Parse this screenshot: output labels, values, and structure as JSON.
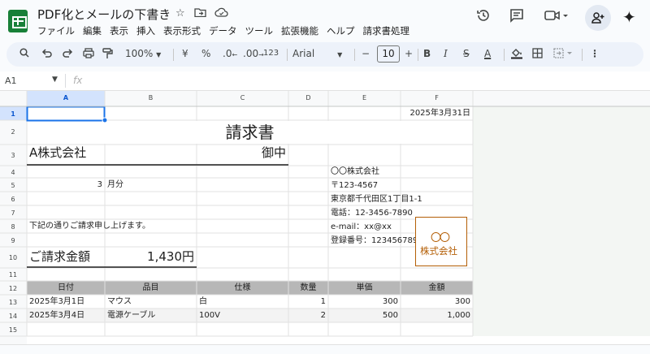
{
  "app": {
    "doc_title": "PDF化とメールの下書き",
    "menu": [
      "ファイル",
      "編集",
      "表示",
      "挿入",
      "表示形式",
      "データ",
      "ツール",
      "拡張機能",
      "ヘルプ",
      "請求書処理"
    ]
  },
  "toolbar": {
    "zoom": "100%",
    "currency": "¥",
    "percent": "%",
    "decrease_decimal": ".0",
    "increase_decimal": ".00",
    "number_format": "123",
    "font": "Arial",
    "font_size": "10",
    "bold": "B",
    "italic": "I",
    "strike": "S",
    "text_color": "A"
  },
  "formula_bar": {
    "name_box": "A1",
    "fx": "fx"
  },
  "columns": [
    "A",
    "B",
    "C",
    "D",
    "E",
    "F"
  ],
  "rows": [
    "1",
    "2",
    "3",
    "4",
    "5",
    "6",
    "7",
    "8",
    "9",
    "10",
    "11",
    "12",
    "13",
    "14",
    "15"
  ],
  "invoice": {
    "date": "2025年3月31日",
    "title": "請求書",
    "client": "A株式会社",
    "honorific": "御中",
    "month_number": "3",
    "month_label": "月分",
    "message": "下記の通りご請求申し上げます。",
    "amount_label": "ご請求金額",
    "amount_value": "1,430円",
    "company": "〇〇株式会社",
    "postal": "〒123-4567",
    "address": "東京都千代田区1丁目1-1",
    "phone": "電話：12-3456-7890",
    "email": "e-mail：xx@xx",
    "registration": "登録番号：1234567890",
    "stamp_circles": "〇〇",
    "stamp_company": "株式会社"
  },
  "table": {
    "headers": [
      "日付",
      "品目",
      "仕様",
      "数量",
      "単価",
      "金額"
    ],
    "rows": [
      [
        "2025年3月1日",
        "マウス",
        "白",
        "1",
        "300",
        "300"
      ],
      [
        "2025年3月4日",
        "電源ケーブル",
        "100V",
        "2",
        "500",
        "1,000"
      ]
    ]
  },
  "colors": {
    "header_fill": "#b7b7b7",
    "selection": "#1a73e8",
    "stamp": "#b45f06",
    "sheets_green": "#188038"
  }
}
